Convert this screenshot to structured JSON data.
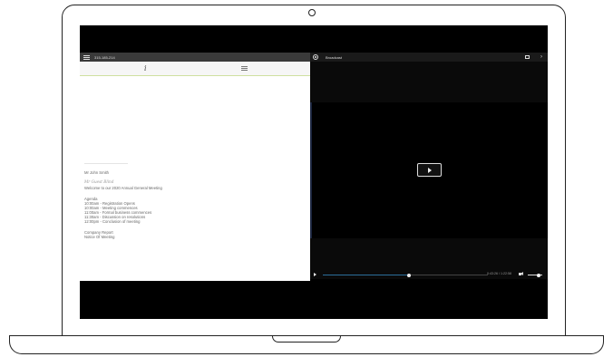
{
  "doc_panel": {
    "meeting_id": "315-185-214",
    "lines": [
      "Mr John Smith",
      "Mr Guest Blind",
      "Welcome to our 2020 Annual General Meeting",
      "",
      "Agenda",
      "10:00am - Registration Opens",
      "10:00am - Meeting commences",
      "11:00am - Formal business commences",
      "11:30am - Discussion on resolutions",
      "12:00pm - Conclusion of meeting",
      "",
      "Company Report",
      "Notice Of Meeting"
    ]
  },
  "video_panel": {
    "title": "Broadcast",
    "progress": 0.52,
    "volume": 0.75,
    "time": "0:43:26 / 1:22:58"
  },
  "icons": {
    "menu": "hamburger-icon",
    "info": "info-icon",
    "notes": "notes-icon",
    "broadcast": "broadcast-icon",
    "fullscreen": "fullscreen-icon",
    "next": "chevron-right-icon",
    "play": "play-icon",
    "volume": "volume-icon"
  },
  "colors": {
    "screen_bg": "#000000",
    "toolbar_accent": "#cfe0a0",
    "progress": "#2c6e9a"
  }
}
